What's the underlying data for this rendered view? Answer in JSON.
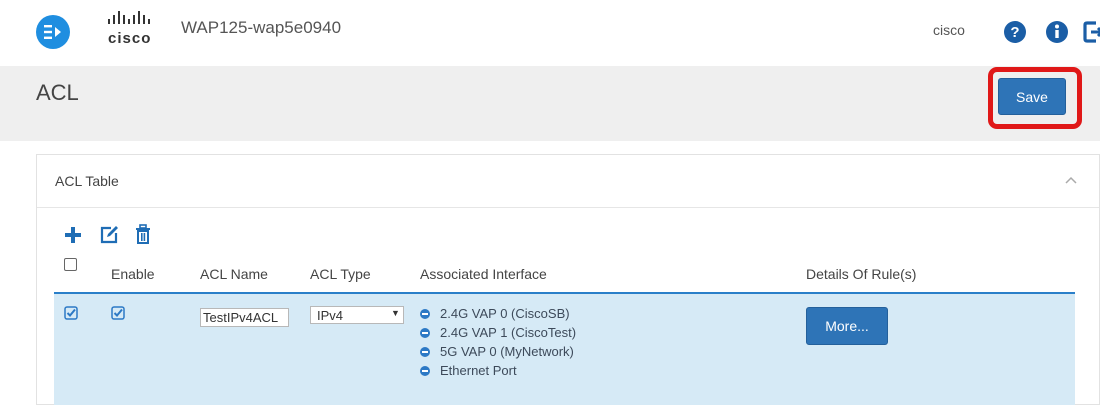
{
  "header": {
    "logo_text": "cisco",
    "app_title": "WAP125-wap5e0940",
    "user": "cisco"
  },
  "page": {
    "title": "ACL",
    "save_label": "Save"
  },
  "panel": {
    "title": "ACL Table",
    "columns": [
      "Enable",
      "ACL Name",
      "ACL Type",
      "Associated Interface",
      "Details Of Rule(s)"
    ]
  },
  "rows": [
    {
      "selected": true,
      "enabled": true,
      "acl_name": "TestIPv4ACL",
      "acl_type": "IPv4",
      "interfaces": [
        "2.4G VAP 0 (CiscoSB)",
        "2.4G VAP 1 (CiscoTest)",
        "5G VAP 0 (MyNetwork)",
        "Ethernet Port"
      ],
      "details_label": "More..."
    }
  ],
  "colors": {
    "accent": "#2e74b7",
    "highlight": "#e01818",
    "row_selected": "#d6eaf6"
  }
}
